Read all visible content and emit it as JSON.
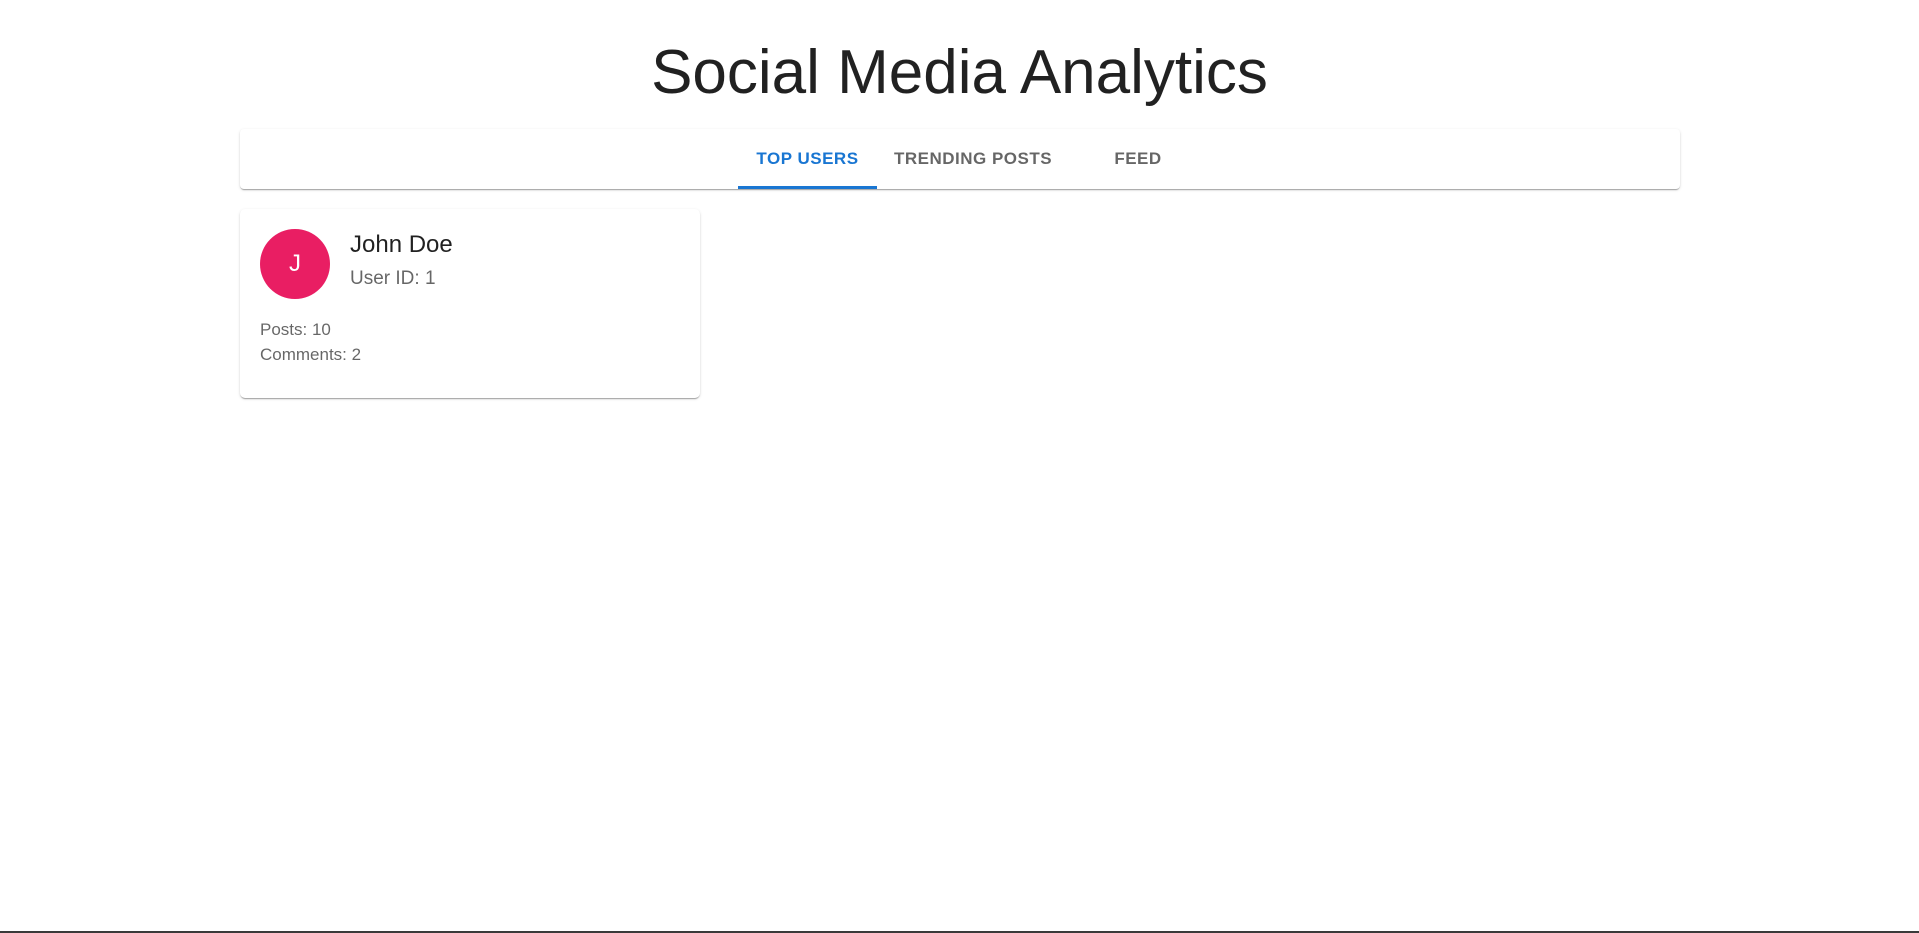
{
  "app": {
    "title": "Social Media Analytics"
  },
  "tabs": [
    {
      "label": "TOP USERS",
      "active": true
    },
    {
      "label": "TRENDING POSTS",
      "active": false
    },
    {
      "label": "FEED",
      "active": false
    }
  ],
  "colors": {
    "accent": "#1976d2",
    "avatar_bg": "#e91e63"
  },
  "users": [
    {
      "avatar_initial": "J",
      "name": "John Doe",
      "user_id_text": "User ID: 1",
      "posts_text": "Posts: 10",
      "comments_text": "Comments: 2"
    }
  ]
}
